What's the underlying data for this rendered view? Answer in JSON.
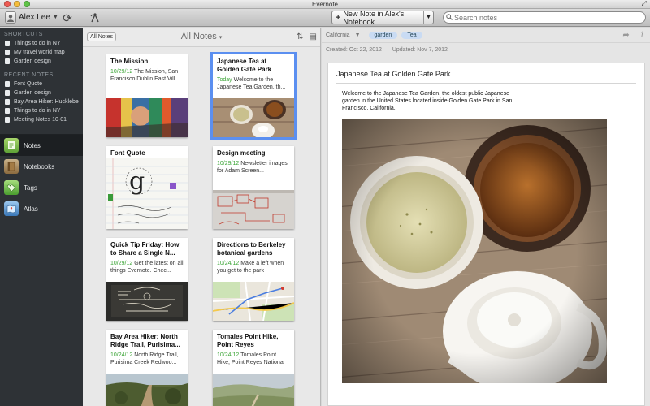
{
  "window": {
    "title": "Evernote",
    "fullscreen_icon": "fullscreen-arrows-icon"
  },
  "colors": {
    "sidebar_bg": "#2e3236",
    "accent_green": "#3aa435",
    "selection_blue": "#5b8ff0",
    "tag_bg": "#c9dbf3"
  },
  "toolbar": {
    "account_name": "Alex Lee",
    "account_icon": "person-icon",
    "sync_icon": "sync-icon",
    "activity_icon": "activity-icon",
    "new_note_label": "New Note in Alex's Notebook",
    "search_placeholder": "Search notes"
  },
  "sidebar": {
    "shortcuts_header": "SHORTCUTS",
    "shortcuts": [
      {
        "label": "Things to do in NY"
      },
      {
        "label": "My travel world map"
      },
      {
        "label": "Garden design"
      }
    ],
    "recent_header": "RECENT NOTES",
    "recent": [
      {
        "label": "Font Quote"
      },
      {
        "label": "Garden design"
      },
      {
        "label": "Bay Area Hiker: Hucklebe"
      },
      {
        "label": "Things to do in NY"
      },
      {
        "label": "Meeting Notes 10-01"
      }
    ],
    "nav": [
      {
        "label": "Notes",
        "icon": "notes-icon",
        "active": true
      },
      {
        "label": "Notebooks",
        "icon": "notebooks-icon"
      },
      {
        "label": "Tags",
        "icon": "tags-icon"
      },
      {
        "label": "Atlas",
        "icon": "atlas-icon"
      }
    ]
  },
  "notes_list": {
    "filter_button": "All Notes",
    "title": "All Notes",
    "cards": [
      {
        "title": "The Mission",
        "date": "10/29/12",
        "snippet": "The Mission, San Francisco Dublin East Vill..."
      },
      {
        "title": "Japanese Tea at Golden Gate Park",
        "date": "Today",
        "snippet": "Welcome to the Japanese Tea Garden, th...",
        "selected": true
      },
      {
        "title": "Font Quote",
        "date": "",
        "snippet": ""
      },
      {
        "title": "Design meeting",
        "date": "10/29/12",
        "snippet": "Newsletter images for Adam Screen..."
      },
      {
        "title": "Quick Tip Friday: How to Share a Single N...",
        "date": "10/29/12",
        "snippet": "Get the latest on all things Evernote. Chec..."
      },
      {
        "title": "Directions to Berkeley botanical gardens",
        "date": "10/24/12",
        "snippet": "Make a left when you get to the park"
      },
      {
        "title": "Bay Area Hiker: North Ridge Trail, Purisima...",
        "date": "10/24/12",
        "snippet": "North Ridge Trail, Purisima Creek Redwoo..."
      },
      {
        "title": "Tomales Point Hike, Point Reyes",
        "date": "10/24/12",
        "snippet": "Tomales Point Hike, Point Reyes National Se..."
      }
    ]
  },
  "note": {
    "notebook": "California",
    "tags": [
      "garden",
      "Tea"
    ],
    "created": "Created: Oct 22, 2012",
    "updated": "Updated: Nov 7, 2012",
    "title": "Japanese Tea at Golden Gate Park",
    "body": "Welcome to the Japanese Tea Garden, the oldest public Japanese garden in the United States located inside Golden Gate Park in San Francisco, California.",
    "share_icon": "share-icon",
    "info_icon": "info-icon"
  }
}
